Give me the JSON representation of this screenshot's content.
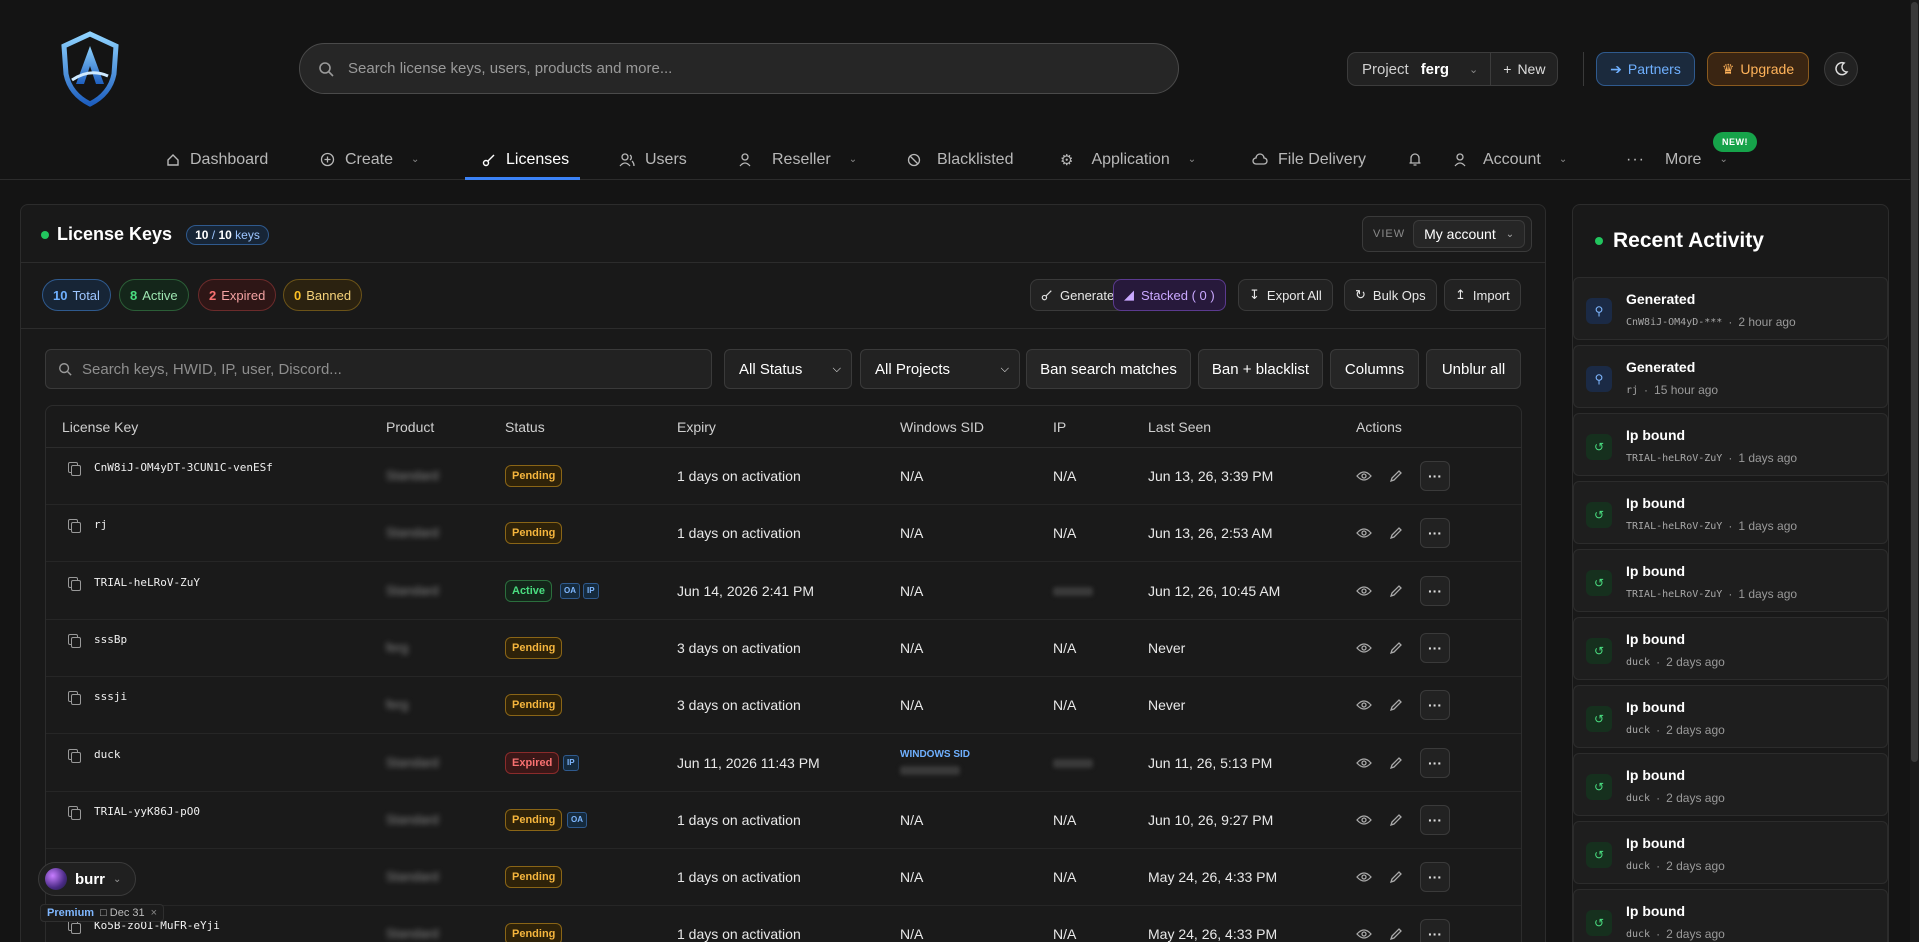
{
  "header": {
    "search_placeholder": "Search license keys, users, products and more...",
    "project_label": "Project",
    "project_value": "ferg",
    "new_label": "New",
    "partners_label": "Partners",
    "upgrade_label": "Upgrade"
  },
  "nav": {
    "items": [
      {
        "label": "Dashboard",
        "icon": "home-icon"
      },
      {
        "label": "Create",
        "icon": "plus-circle-icon",
        "dropdown": true
      },
      {
        "label": "Licenses",
        "icon": "key-icon",
        "active": true
      },
      {
        "label": "Users",
        "icon": "users-icon"
      },
      {
        "label": "Reseller",
        "icon": "user-icon",
        "dropdown": true
      },
      {
        "label": "Blacklisted",
        "icon": "ban-icon"
      },
      {
        "label": "Application",
        "icon": "gear-icon",
        "dropdown": true
      },
      {
        "label": "File Delivery",
        "icon": "cloud-icon"
      },
      {
        "label": "",
        "icon": "bell-icon"
      },
      {
        "label": "Account",
        "icon": "user-icon",
        "dropdown": true
      },
      {
        "label": "More",
        "icon": "ellipsis-icon",
        "dropdown": true
      }
    ],
    "new_badge": "NEW!"
  },
  "licenses": {
    "title": "License Keys",
    "count_a": "10",
    "count_b": "10",
    "count_suffix": "keys",
    "view_label": "VIEW",
    "view_value": "My account",
    "stats": {
      "total_n": "10",
      "total_label": "Total",
      "active_n": "8",
      "active_label": "Active",
      "expired_n": "2",
      "expired_label": "Expired",
      "banned_n": "0",
      "banned_label": "Banned"
    },
    "actions": {
      "generate": "Generate",
      "stacked": "Stacked ( 0 )",
      "export_all": "Export All",
      "bulk_ops": "Bulk Ops",
      "import": "Import"
    },
    "filters": {
      "search_placeholder": "Search keys, HWID, IP, user, Discord...",
      "status": "All Status",
      "projects": "All Projects",
      "ban_matches": "Ban search matches",
      "ban_blacklist": "Ban + blacklist",
      "columns": "Columns",
      "unblur": "Unblur all"
    },
    "columns": [
      "License Key",
      "Product",
      "Status",
      "Expiry",
      "Windows SID",
      "IP",
      "Last Seen",
      "Actions"
    ],
    "rows": [
      {
        "key": "CnW8iJ-OM4yDT-3CUN1C-venESf",
        "product": "Standard",
        "status": "Pending",
        "tags": [],
        "expiry": "1 days on activation",
        "sid": "N/A",
        "ip": "N/A",
        "last_seen": "Jun 13, 26, 3:39 PM"
      },
      {
        "key": "rj",
        "product": "Standard",
        "status": "Pending",
        "tags": [],
        "expiry": "1 days on activation",
        "sid": "N/A",
        "ip": "N/A",
        "last_seen": "Jun 13, 26, 2:53 AM"
      },
      {
        "key": "TRIAL-heLRoV-ZuY",
        "product": "Standard",
        "status": "Active",
        "tags": [
          "OA",
          "IP"
        ],
        "expiry": "Jun 14, 2026 2:41 PM",
        "sid": "N/A",
        "ip": "hidden",
        "last_seen": "Jun 12, 26, 10:45 AM"
      },
      {
        "key": "sssBp",
        "product": "ferg",
        "status": "Pending",
        "tags": [],
        "expiry": "3 days on activation",
        "sid": "N/A",
        "ip": "N/A",
        "last_seen": "Never"
      },
      {
        "key": "sssji",
        "product": "ferg",
        "status": "Pending",
        "tags": [],
        "expiry": "3 days on activation",
        "sid": "N/A",
        "ip": "N/A",
        "last_seen": "Never"
      },
      {
        "key": "duck",
        "product": "Standard",
        "status": "Expired",
        "tags": [
          "IP"
        ],
        "expiry": "Jun 11, 2026 11:43 PM",
        "sid": "WINDOWS SID",
        "ip": "hidden",
        "last_seen": "Jun 11, 26, 5:13 PM"
      },
      {
        "key": "TRIAL-yyK86J-pO0",
        "product": "Standard",
        "status": "Pending",
        "tags": [
          "OA"
        ],
        "expiry": "1 days on activation",
        "sid": "N/A",
        "ip": "N/A",
        "last_seen": "Jun 10, 26, 9:27 PM"
      },
      {
        "key": "",
        "product": "Standard",
        "status": "Pending",
        "tags": [],
        "expiry": "1 days on activation",
        "sid": "N/A",
        "ip": "N/A",
        "last_seen": "May 24, 26, 4:33 PM"
      },
      {
        "key": "Ko5B-zoOI-MuFR-eYji",
        "product": "Standard",
        "status": "Pending",
        "tags": [],
        "expiry": "1 days on activation",
        "sid": "N/A",
        "ip": "N/A",
        "last_seen": "May 24, 26, 4:33 PM"
      }
    ]
  },
  "user": {
    "name": "burr",
    "plan": "Premium",
    "date": "Dec 31"
  },
  "activity": {
    "title": "Recent Activity",
    "items": [
      {
        "type": "gen",
        "title": "Generated",
        "key": "CnW8iJ-OM4yD-***",
        "time": "2 hour ago"
      },
      {
        "type": "gen",
        "title": "Generated",
        "key": "rj",
        "time": "15 hour ago"
      },
      {
        "type": "ip",
        "title": "Ip bound",
        "key": "TRIAL-heLRoV-ZuY",
        "time": "1 days ago"
      },
      {
        "type": "ip",
        "title": "Ip bound",
        "key": "TRIAL-heLRoV-ZuY",
        "time": "1 days ago"
      },
      {
        "type": "ip",
        "title": "Ip bound",
        "key": "TRIAL-heLRoV-ZuY",
        "time": "1 days ago"
      },
      {
        "type": "ip",
        "title": "Ip bound",
        "key": "duck",
        "time": "2 days ago"
      },
      {
        "type": "ip",
        "title": "Ip bound",
        "key": "duck",
        "time": "2 days ago"
      },
      {
        "type": "ip",
        "title": "Ip bound",
        "key": "duck",
        "time": "2 days ago"
      },
      {
        "type": "ip",
        "title": "Ip bound",
        "key": "duck",
        "time": "2 days ago"
      },
      {
        "type": "ip",
        "title": "Ip bound",
        "key": "duck",
        "time": "2 days ago"
      }
    ]
  }
}
